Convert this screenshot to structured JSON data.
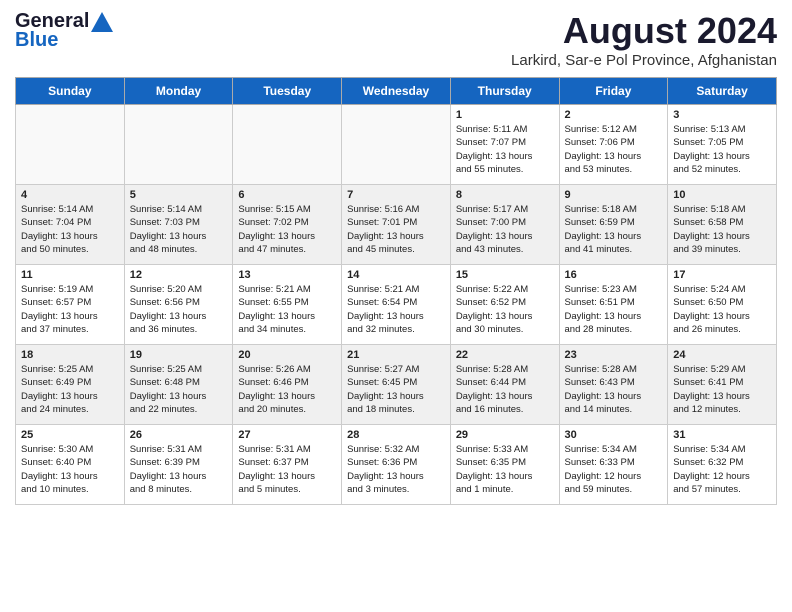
{
  "header": {
    "logo_line1": "General",
    "logo_line2": "Blue",
    "main_title": "August 2024",
    "subtitle": "Larkird, Sar-e Pol Province, Afghanistan"
  },
  "calendar": {
    "days_of_week": [
      "Sunday",
      "Monday",
      "Tuesday",
      "Wednesday",
      "Thursday",
      "Friday",
      "Saturday"
    ],
    "weeks": [
      [
        {
          "day": "",
          "text": ""
        },
        {
          "day": "",
          "text": ""
        },
        {
          "day": "",
          "text": ""
        },
        {
          "day": "",
          "text": ""
        },
        {
          "day": "1",
          "text": "Sunrise: 5:11 AM\nSunset: 7:07 PM\nDaylight: 13 hours\nand 55 minutes."
        },
        {
          "day": "2",
          "text": "Sunrise: 5:12 AM\nSunset: 7:06 PM\nDaylight: 13 hours\nand 53 minutes."
        },
        {
          "day": "3",
          "text": "Sunrise: 5:13 AM\nSunset: 7:05 PM\nDaylight: 13 hours\nand 52 minutes."
        }
      ],
      [
        {
          "day": "4",
          "text": "Sunrise: 5:14 AM\nSunset: 7:04 PM\nDaylight: 13 hours\nand 50 minutes."
        },
        {
          "day": "5",
          "text": "Sunrise: 5:14 AM\nSunset: 7:03 PM\nDaylight: 13 hours\nand 48 minutes."
        },
        {
          "day": "6",
          "text": "Sunrise: 5:15 AM\nSunset: 7:02 PM\nDaylight: 13 hours\nand 47 minutes."
        },
        {
          "day": "7",
          "text": "Sunrise: 5:16 AM\nSunset: 7:01 PM\nDaylight: 13 hours\nand 45 minutes."
        },
        {
          "day": "8",
          "text": "Sunrise: 5:17 AM\nSunset: 7:00 PM\nDaylight: 13 hours\nand 43 minutes."
        },
        {
          "day": "9",
          "text": "Sunrise: 5:18 AM\nSunset: 6:59 PM\nDaylight: 13 hours\nand 41 minutes."
        },
        {
          "day": "10",
          "text": "Sunrise: 5:18 AM\nSunset: 6:58 PM\nDaylight: 13 hours\nand 39 minutes."
        }
      ],
      [
        {
          "day": "11",
          "text": "Sunrise: 5:19 AM\nSunset: 6:57 PM\nDaylight: 13 hours\nand 37 minutes."
        },
        {
          "day": "12",
          "text": "Sunrise: 5:20 AM\nSunset: 6:56 PM\nDaylight: 13 hours\nand 36 minutes."
        },
        {
          "day": "13",
          "text": "Sunrise: 5:21 AM\nSunset: 6:55 PM\nDaylight: 13 hours\nand 34 minutes."
        },
        {
          "day": "14",
          "text": "Sunrise: 5:21 AM\nSunset: 6:54 PM\nDaylight: 13 hours\nand 32 minutes."
        },
        {
          "day": "15",
          "text": "Sunrise: 5:22 AM\nSunset: 6:52 PM\nDaylight: 13 hours\nand 30 minutes."
        },
        {
          "day": "16",
          "text": "Sunrise: 5:23 AM\nSunset: 6:51 PM\nDaylight: 13 hours\nand 28 minutes."
        },
        {
          "day": "17",
          "text": "Sunrise: 5:24 AM\nSunset: 6:50 PM\nDaylight: 13 hours\nand 26 minutes."
        }
      ],
      [
        {
          "day": "18",
          "text": "Sunrise: 5:25 AM\nSunset: 6:49 PM\nDaylight: 13 hours\nand 24 minutes."
        },
        {
          "day": "19",
          "text": "Sunrise: 5:25 AM\nSunset: 6:48 PM\nDaylight: 13 hours\nand 22 minutes."
        },
        {
          "day": "20",
          "text": "Sunrise: 5:26 AM\nSunset: 6:46 PM\nDaylight: 13 hours\nand 20 minutes."
        },
        {
          "day": "21",
          "text": "Sunrise: 5:27 AM\nSunset: 6:45 PM\nDaylight: 13 hours\nand 18 minutes."
        },
        {
          "day": "22",
          "text": "Sunrise: 5:28 AM\nSunset: 6:44 PM\nDaylight: 13 hours\nand 16 minutes."
        },
        {
          "day": "23",
          "text": "Sunrise: 5:28 AM\nSunset: 6:43 PM\nDaylight: 13 hours\nand 14 minutes."
        },
        {
          "day": "24",
          "text": "Sunrise: 5:29 AM\nSunset: 6:41 PM\nDaylight: 13 hours\nand 12 minutes."
        }
      ],
      [
        {
          "day": "25",
          "text": "Sunrise: 5:30 AM\nSunset: 6:40 PM\nDaylight: 13 hours\nand 10 minutes."
        },
        {
          "day": "26",
          "text": "Sunrise: 5:31 AM\nSunset: 6:39 PM\nDaylight: 13 hours\nand 8 minutes."
        },
        {
          "day": "27",
          "text": "Sunrise: 5:31 AM\nSunset: 6:37 PM\nDaylight: 13 hours\nand 5 minutes."
        },
        {
          "day": "28",
          "text": "Sunrise: 5:32 AM\nSunset: 6:36 PM\nDaylight: 13 hours\nand 3 minutes."
        },
        {
          "day": "29",
          "text": "Sunrise: 5:33 AM\nSunset: 6:35 PM\nDaylight: 13 hours\nand 1 minute."
        },
        {
          "day": "30",
          "text": "Sunrise: 5:34 AM\nSunset: 6:33 PM\nDaylight: 12 hours\nand 59 minutes."
        },
        {
          "day": "31",
          "text": "Sunrise: 5:34 AM\nSunset: 6:32 PM\nDaylight: 12 hours\nand 57 minutes."
        }
      ]
    ]
  }
}
